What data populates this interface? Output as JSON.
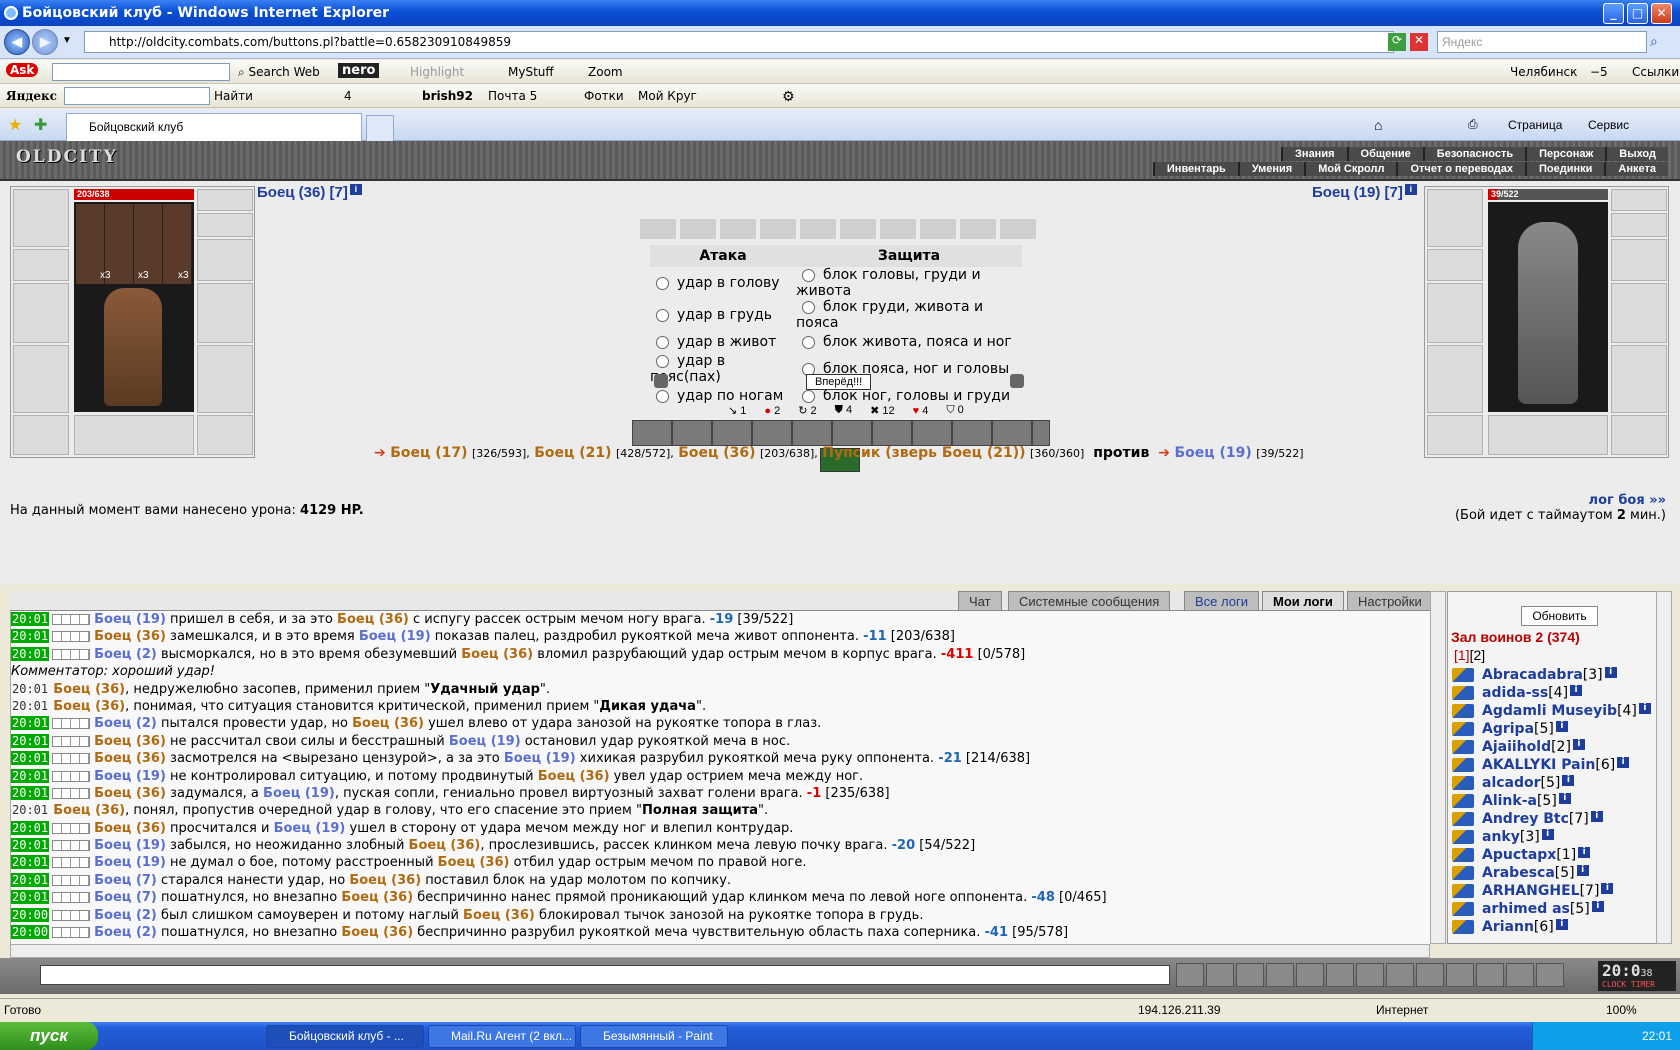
{
  "window": {
    "title": "Бойцовский клуб - Windows Internet Explorer"
  },
  "address": {
    "url": "http://oldcity.combats.com/buttons.pl?battle=0.658230910849859",
    "search_placeholder": "Яндекс"
  },
  "ask_toolbar": {
    "logo": "Ask",
    "search_web": "Search Web",
    "nero": "nero",
    "highlight": "Highlight",
    "mystuff": "MyStuff",
    "zoom": "Zoom",
    "city": "Челябинск",
    "temp": "−5",
    "links": "Ссылки"
  },
  "yandex_toolbar": {
    "logo": "Яндекс",
    "find": "Найти",
    "comments": "4",
    "user": "brish92",
    "mail": "Почта 5",
    "photos": "Фотки",
    "myclub": "Мой Круг"
  },
  "tab": {
    "label": "Бойцовский клуб"
  },
  "ie_cmd": {
    "page": "Страница",
    "service": "Сервис"
  },
  "game_menu": {
    "row1": [
      "Знания",
      "Общение",
      "Безопасность",
      "Персонаж",
      "Выход"
    ],
    "row2": [
      "Инвентарь",
      "Умения",
      "Мой Скролл",
      "Отчет о переводах",
      "Поединки",
      "Анкета"
    ],
    "logo": "OLDCITY"
  },
  "left_fighter": {
    "name": "Боец (36) [7]",
    "hp": "203/638",
    "x3a": "x3",
    "x3b": "x3",
    "x3c": "x3"
  },
  "right_fighter": {
    "name": "Боец (19) [7]",
    "hp": "39/522"
  },
  "battle": {
    "attack_header": "Атака",
    "defense_header": "Защита",
    "attacks": [
      "удар в голову",
      "удар в грудь",
      "удар в живот",
      "удар в пояс(пах)",
      "удар по ногам"
    ],
    "defenses": [
      "блок головы, груди и живота",
      "блок груди, живота и пояса",
      "блок живота, пояса и ног",
      "блок пояса, ног и головы",
      "блок ног, головы и груди"
    ],
    "go_button": "Вперёд!!!",
    "stats": [
      "1",
      "2",
      "2",
      "4",
      "12",
      "4",
      "0"
    ]
  },
  "teams": {
    "t1": "Боец (17)",
    "t1hp": "[326/593],",
    "t2": "Боец (21)",
    "t2hp": "[428/572],",
    "t3": "Боец (36)",
    "t3hp": "[203/638],",
    "t4": "Пупсик (зверь Боец (21))",
    "t4hp": "[360/360]",
    "vs": "против",
    "e1": "Боец (19)",
    "e1hp": "[39/522]"
  },
  "damage": {
    "text": "На данный момент вами нанесено урона:",
    "value": "4129 HP.",
    "log_link": "лог боя »»",
    "timeout_a": "(Бой идет с таймаутом",
    "timeout_b": "2",
    "timeout_c": "мин.)"
  },
  "log_tabs": [
    "Чат",
    "Системные сообщения",
    "Все логи",
    "Мои логи",
    "Настройки"
  ],
  "log_lines": [
    {
      "t": "20:01",
      "hl": true,
      "sq": true,
      "parts": [
        [
          "e",
          "Боец (19)"
        ],
        [
          "n",
          " пришел в себя, и за это "
        ],
        [
          "m",
          "Боец (36)"
        ],
        [
          "n",
          " с испугу рассек острым мечом ногу врага. "
        ],
        [
          "b",
          "-19"
        ],
        [
          "n",
          " [39/522]"
        ]
      ]
    },
    {
      "t": "20:01",
      "hl": true,
      "sq": true,
      "parts": [
        [
          "m",
          "Боец (36)"
        ],
        [
          "n",
          " замешкался, и в это время "
        ],
        [
          "e",
          "Боец (19)"
        ],
        [
          "n",
          " показав палец, раздробил рукояткой меча живот оппонента. "
        ],
        [
          "b",
          "-11"
        ],
        [
          "n",
          " [203/638]"
        ]
      ]
    },
    {
      "t": "20:01",
      "hl": true,
      "sq": true,
      "parts": [
        [
          "e",
          "Боец (2)"
        ],
        [
          "n",
          " высморкался, но в это время обезумевший "
        ],
        [
          "m",
          "Боец (36)"
        ],
        [
          "n",
          " вломил разрубающий удар острым мечом в корпус врага. "
        ],
        [
          "d",
          "-411"
        ],
        [
          "n",
          " [0/578]"
        ]
      ]
    },
    {
      "t": "",
      "hl": false,
      "sq": false,
      "parts": [
        [
          "i",
          "Комментатор: хороший удар!"
        ]
      ]
    },
    {
      "t": "20:01",
      "hl": false,
      "sq": false,
      "parts": [
        [
          "m",
          "Боец (36)"
        ],
        [
          "n",
          ", недружелюбно засопев, применил прием \""
        ],
        [
          "k",
          "Удачный удар"
        ],
        [
          "n",
          "\"."
        ]
      ]
    },
    {
      "t": "20:01",
      "hl": false,
      "sq": false,
      "parts": [
        [
          "m",
          "Боец (36)"
        ],
        [
          "n",
          ", понимая, что ситуация становится критической, применил прием \""
        ],
        [
          "k",
          "Дикая удача"
        ],
        [
          "n",
          "\"."
        ]
      ]
    },
    {
      "t": "20:01",
      "hl": true,
      "sq": true,
      "parts": [
        [
          "e",
          "Боец (2)"
        ],
        [
          "n",
          " пытался провести удар, но "
        ],
        [
          "m",
          "Боец (36)"
        ],
        [
          "n",
          " ушел влево от удара занозой на рукоятке топора в глаз."
        ]
      ]
    },
    {
      "t": "20:01",
      "hl": true,
      "sq": true,
      "parts": [
        [
          "m",
          "Боец (36)"
        ],
        [
          "n",
          " не рассчитал свои силы и бесстрашный "
        ],
        [
          "e",
          "Боец (19)"
        ],
        [
          "n",
          " остановил удар рукояткой меча в нос."
        ]
      ]
    },
    {
      "t": "20:01",
      "hl": true,
      "sq": true,
      "parts": [
        [
          "m",
          "Боец (36)"
        ],
        [
          "n",
          " засмотрелся на <вырезано цензурой>, а за это "
        ],
        [
          "e",
          "Боец (19)"
        ],
        [
          "n",
          " хихикая разрубил рукояткой меча руку оппонента. "
        ],
        [
          "b",
          "-21"
        ],
        [
          "n",
          " [214/638]"
        ]
      ]
    },
    {
      "t": "20:01",
      "hl": true,
      "sq": true,
      "parts": [
        [
          "e",
          "Боец (19)"
        ],
        [
          "n",
          " не контролировал ситуацию, и потому продвинутый "
        ],
        [
          "m",
          "Боец (36)"
        ],
        [
          "n",
          " увел удар острием меча между ног."
        ]
      ]
    },
    {
      "t": "20:01",
      "hl": true,
      "sq": true,
      "parts": [
        [
          "m",
          "Боец (36)"
        ],
        [
          "n",
          " задумался, а "
        ],
        [
          "e",
          "Боец (19)"
        ],
        [
          "n",
          ", пуская сопли, гениально провел виртуозный захват голени врага. "
        ],
        [
          "d",
          "-1"
        ],
        [
          "n",
          " [235/638]"
        ]
      ]
    },
    {
      "t": "20:01",
      "hl": false,
      "sq": false,
      "parts": [
        [
          "m",
          "Боец (36)"
        ],
        [
          "n",
          ", понял, пропустив очередной удар в голову, что его спасение это прием \""
        ],
        [
          "k",
          "Полная защита"
        ],
        [
          "n",
          "\"."
        ]
      ]
    },
    {
      "t": "20:01",
      "hl": true,
      "sq": true,
      "parts": [
        [
          "m",
          "Боец (36)"
        ],
        [
          "n",
          " просчитался и "
        ],
        [
          "e",
          "Боец (19)"
        ],
        [
          "n",
          " ушел в сторону от удара мечом между ног и влепил контрудар."
        ]
      ]
    },
    {
      "t": "20:01",
      "hl": true,
      "sq": true,
      "parts": [
        [
          "e",
          "Боец (19)"
        ],
        [
          "n",
          " забылся, но неожиданно злобный "
        ],
        [
          "m",
          "Боец (36)"
        ],
        [
          "n",
          ", прослезившись, рассек клинком меча левую почку врага. "
        ],
        [
          "b",
          "-20"
        ],
        [
          "n",
          " [54/522]"
        ]
      ]
    },
    {
      "t": "20:01",
      "hl": true,
      "sq": true,
      "parts": [
        [
          "e",
          "Боец (19)"
        ],
        [
          "n",
          " не думал о бое, потому расстроенный "
        ],
        [
          "m",
          "Боец (36)"
        ],
        [
          "n",
          " отбил удар острым мечом по правой ноге."
        ]
      ]
    },
    {
      "t": "20:01",
      "hl": true,
      "sq": true,
      "parts": [
        [
          "e",
          "Боец (7)"
        ],
        [
          "n",
          " старался нанести удар, но "
        ],
        [
          "m",
          "Боец (36)"
        ],
        [
          "n",
          " поставил блок на удар молотом по копчику."
        ]
      ]
    },
    {
      "t": "20:01",
      "hl": true,
      "sq": true,
      "parts": [
        [
          "e",
          "Боец (7)"
        ],
        [
          "n",
          " пошатнулся, но внезапно "
        ],
        [
          "m",
          "Боец (36)"
        ],
        [
          "n",
          " беспричинно нанес прямой проникающий удар клинком меча по левой ноге оппонента. "
        ],
        [
          "b",
          "-48"
        ],
        [
          "n",
          " [0/465]"
        ]
      ]
    },
    {
      "t": "20:00",
      "hl": true,
      "sq": true,
      "parts": [
        [
          "e",
          "Боец (2)"
        ],
        [
          "n",
          " был слишком самоуверен и потому наглый "
        ],
        [
          "m",
          "Боец (36)"
        ],
        [
          "n",
          " блокировал тычок занозой на рукоятке топора в грудь."
        ]
      ]
    },
    {
      "t": "20:00",
      "hl": true,
      "sq": true,
      "parts": [
        [
          "e",
          "Боец (2)"
        ],
        [
          "n",
          " пошатнулся, но внезапно "
        ],
        [
          "m",
          "Боец (36)"
        ],
        [
          "n",
          " беспричинно разрубил рукояткой меча чувствительную область паха соперника. "
        ],
        [
          "b",
          "-41"
        ],
        [
          "n",
          " [95/578]"
        ]
      ]
    }
  ],
  "side": {
    "refresh": "Обновить",
    "hall": "Зал воинов 2 (374)",
    "pages": [
      "[1]",
      "[2]"
    ],
    "players": [
      [
        "Abracadabra",
        "[3]"
      ],
      [
        "adida-ss",
        "[4]"
      ],
      [
        "Agdamli Museyib",
        "[4]"
      ],
      [
        "Agripa",
        "[5]"
      ],
      [
        "Ajaiihold",
        "[2]"
      ],
      [
        "AKALLYKI Pain",
        "[6]"
      ],
      [
        "alcador",
        "[5]"
      ],
      [
        "Alink-a",
        "[5]"
      ],
      [
        "Andrey Btc",
        "[7]"
      ],
      [
        "anky",
        "[3]"
      ],
      [
        "Apuctapx",
        "[1]"
      ],
      [
        "Arabesca",
        "[5]"
      ],
      [
        "ARHANGHEL",
        "[7]"
      ],
      [
        "arhimed as",
        "[5]"
      ],
      [
        "Ariann",
        "[6]"
      ]
    ]
  },
  "clock": {
    "time": "20:0",
    "sec": "38",
    "label": "CLOCK TIMER"
  },
  "status": {
    "ready": "Готово",
    "ip": "194.126.211.39",
    "zone": "Интернет",
    "zoom": "100%"
  },
  "taskbar": {
    "start": "пуск",
    "tasks": [
      "Бойцовский клуб - ...",
      "Mail.Ru Агент (2 вкл...",
      "Безымянный - Paint"
    ],
    "time": "22:01"
  }
}
